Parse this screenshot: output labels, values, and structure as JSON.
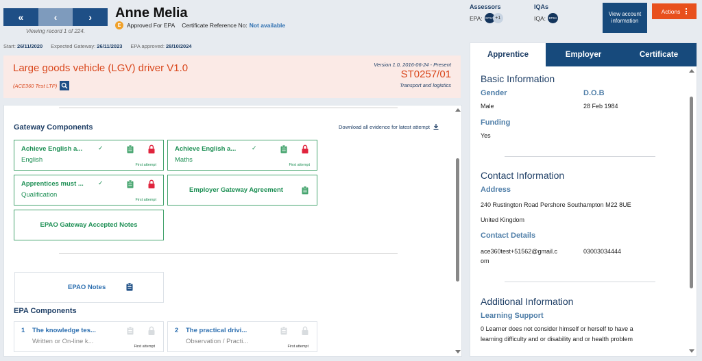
{
  "nav": {
    "first": "«",
    "prev": "‹",
    "next": "›",
    "viewing": "Viewing record 1 of 224."
  },
  "learner": {
    "name": "Anne Melia",
    "status_badge": "E",
    "status": "Approved For EPA",
    "cert_label": "Certificate Reference No:",
    "cert_value": "Not available"
  },
  "assessors": {
    "title": "Assessors",
    "epa_label": "EPA:",
    "avatar": "EPSA",
    "more": "+1"
  },
  "iqas": {
    "title": "IQAs",
    "iqa_label": "IQA:",
    "avatar": "EPSA"
  },
  "buttons": {
    "view_account": "View account information",
    "actions": "Actions"
  },
  "dates": {
    "start_label": "Start:",
    "start": "26/11/2020",
    "gateway_label": "Expected Gateway:",
    "gateway": "26/11/2023",
    "approved_label": "EPA approved:",
    "approved": "28/10/2024"
  },
  "standard": {
    "title": "Large goods vehicle (LGV) driver V1.0",
    "provider": "(ACE360 Test LTP)",
    "version": "Version 1.0, 2016-06-24 - Present",
    "code": "ST0257/01",
    "sector": "Transport and logistics"
  },
  "gateway": {
    "title": "Gateway Components",
    "download": "Download all evidence for latest attempt",
    "cards": [
      {
        "title": "Achieve English a...",
        "subtitle": "English",
        "attempt": "First attempt"
      },
      {
        "title": "Achieve English a...",
        "subtitle": "Maths",
        "attempt": "First attempt"
      },
      {
        "title": "Apprentices must ...",
        "subtitle": "Qualification",
        "attempt": "First attempt"
      }
    ],
    "employer_agreement": "Employer Gateway Agreement",
    "accepted_notes": "EPAO Gateway Accepted Notes"
  },
  "notes": {
    "label": "EPAO Notes"
  },
  "epa": {
    "title": "EPA Components",
    "cards": [
      {
        "num": "1",
        "title": "The knowledge tes...",
        "subtitle": "Written or On-line k...",
        "attempt": "First attempt"
      },
      {
        "num": "2",
        "title": "The practical drivi...",
        "subtitle": "Observation / Practi...",
        "attempt": "First attempt"
      }
    ]
  },
  "tabs": [
    "Apprentice",
    "Employer",
    "Certificate"
  ],
  "basic": {
    "title": "Basic Information",
    "gender_label": "Gender",
    "gender": "Male",
    "dob_label": "D.O.B",
    "dob": "28 Feb 1984",
    "funding_label": "Funding",
    "funding": "Yes"
  },
  "contact": {
    "title": "Contact Information",
    "address_label": "Address",
    "address_line1": "240 Rustington Road Pershore Southampton M22 8UE",
    "address_line2": "United Kingdom",
    "details_label": "Contact Details",
    "email_line1": "ace360test+51562@gmail.c",
    "email_line2": "om",
    "phone": "03003034444"
  },
  "additional": {
    "title": "Additional Information",
    "support_label": "Learning Support",
    "support_line1": "0 Learner does not consider himself or herself to have a",
    "support_line2": "learning difficulty and or disability and or health problem"
  },
  "colors": {
    "navy": "#174a7c",
    "accent_orange": "#e8501d",
    "green": "#1d8f54",
    "blue_label": "#2d6fb0"
  }
}
